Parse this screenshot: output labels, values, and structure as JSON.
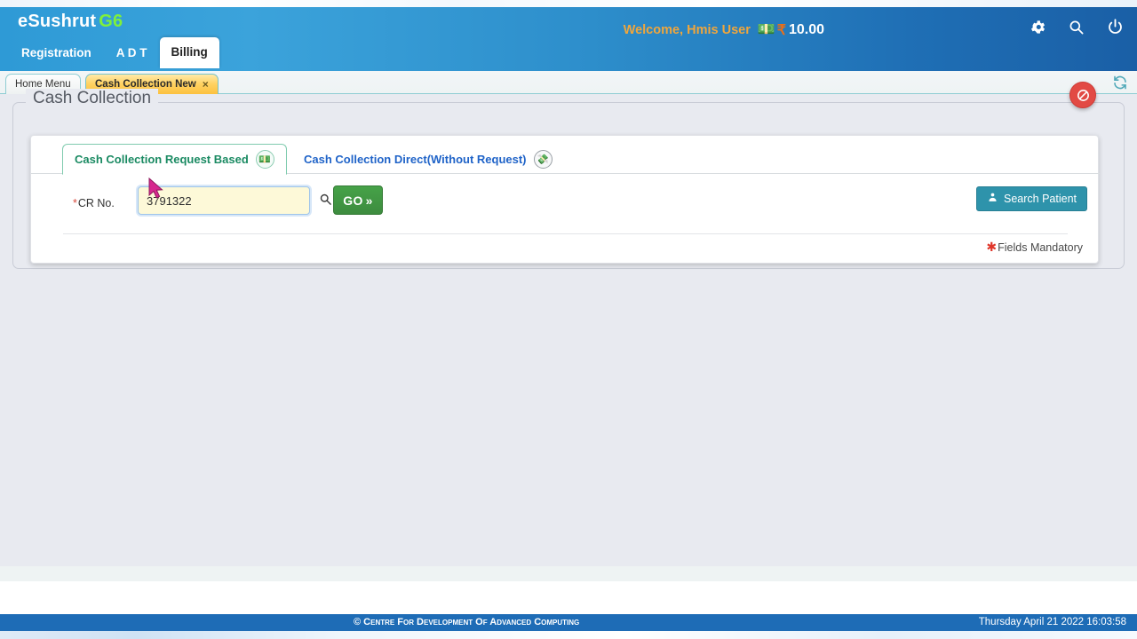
{
  "header": {
    "brand_name": "eSushrut",
    "brand_suffix": "G6",
    "menu": [
      {
        "label": "Registration",
        "active": false
      },
      {
        "label": "A D T",
        "active": false
      },
      {
        "label": "Billing",
        "active": true
      }
    ],
    "welcome_text": "Welcome, Hmis User",
    "money_icon": "money-roll-icon",
    "currency_symbol": "₹",
    "balance": "10.00",
    "icons": [
      {
        "name": "gear-icon"
      },
      {
        "name": "search-icon"
      },
      {
        "name": "power-icon"
      }
    ],
    "colors": {
      "header_from": "#2e9ad6",
      "header_to": "#1a5fa6",
      "brand_accent": "#7ff03a",
      "welcome": "#f0a63c",
      "rupee": "#e8701a"
    }
  },
  "tabbar": {
    "tabs": [
      {
        "label": "Home Menu",
        "active": false,
        "closable": false
      },
      {
        "label": "Cash Collection New",
        "active": true,
        "closable": true,
        "close_glyph": "×"
      }
    ],
    "refresh_icon": "refresh-icon"
  },
  "page": {
    "title": "Cash Collection",
    "close_button": {
      "name": "block-close-icon",
      "color": "#e24a44"
    }
  },
  "subtabs": [
    {
      "label": "Cash Collection Request Based",
      "selected": true,
      "icon": "cash-roll-badge-icon"
    },
    {
      "label": "Cash Collection Direct(Without Request)",
      "selected": false,
      "icon": "cash-roll-badge-icon"
    }
  ],
  "form": {
    "cr_no": {
      "label": "CR No.",
      "required_marker": "*",
      "value": "3791322",
      "placeholder": ""
    },
    "search_icon": "magnifier-icon",
    "go_button": {
      "label": "GO",
      "chevron": "»"
    },
    "search_patient_button": {
      "label": "Search Patient",
      "icon": "patient-icon"
    },
    "mandatory_note": {
      "marker": "✱",
      "text": "Fields Mandatory"
    }
  },
  "footer": {
    "copyright": "© Centre For Development Of Advanced Computing",
    "datetime": "Thursday April 21 2022 16:03:58",
    "background": "#1e6cb6"
  },
  "cursor": {
    "name": "mouse-pointer",
    "color": "#d6288f"
  }
}
